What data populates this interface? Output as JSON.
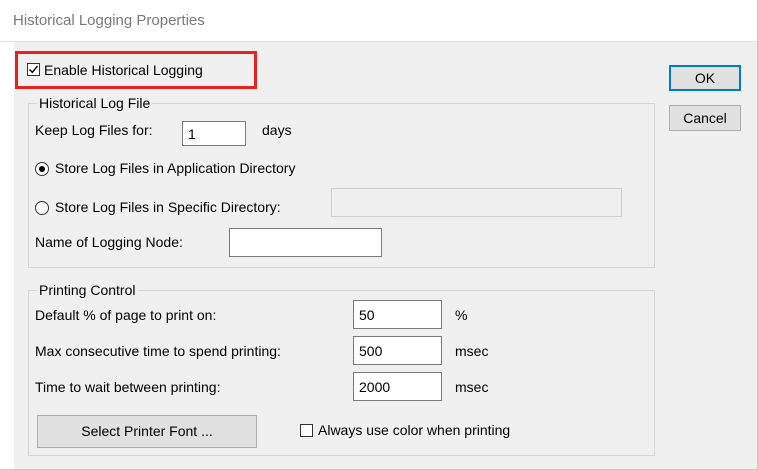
{
  "window": {
    "title": "Historical Logging Properties"
  },
  "enable_logging": {
    "label": "Enable Historical Logging",
    "checked": true
  },
  "log_file_group": {
    "title": "Historical Log File",
    "keep_label": "Keep Log Files for:",
    "keep_value": "1",
    "keep_unit": "days",
    "store_app_label": "Store Log Files in Application Directory",
    "store_app_selected": true,
    "store_specific_label": "Store Log Files in Specific Directory:",
    "store_specific_selected": false,
    "specific_dir_value": "",
    "node_label": "Name of Logging Node:",
    "node_value": ""
  },
  "printing_group": {
    "title": "Printing Control",
    "rows": [
      {
        "label": "Default % of page to print on:",
        "value": "50",
        "unit": "%"
      },
      {
        "label": "Max consecutive time to spend printing:",
        "value": "500",
        "unit": "msec"
      },
      {
        "label": "Time to wait between printing:",
        "value": "2000",
        "unit": "msec"
      }
    ],
    "font_button_label": "Select Printer Font ...",
    "color_checkbox_label": "Always use color when printing",
    "color_checked": false
  },
  "buttons": {
    "ok_label": "OK",
    "cancel_label": "Cancel"
  },
  "colors": {
    "highlight": "#e8231f",
    "dialog_bg": "#f0f0f0"
  }
}
